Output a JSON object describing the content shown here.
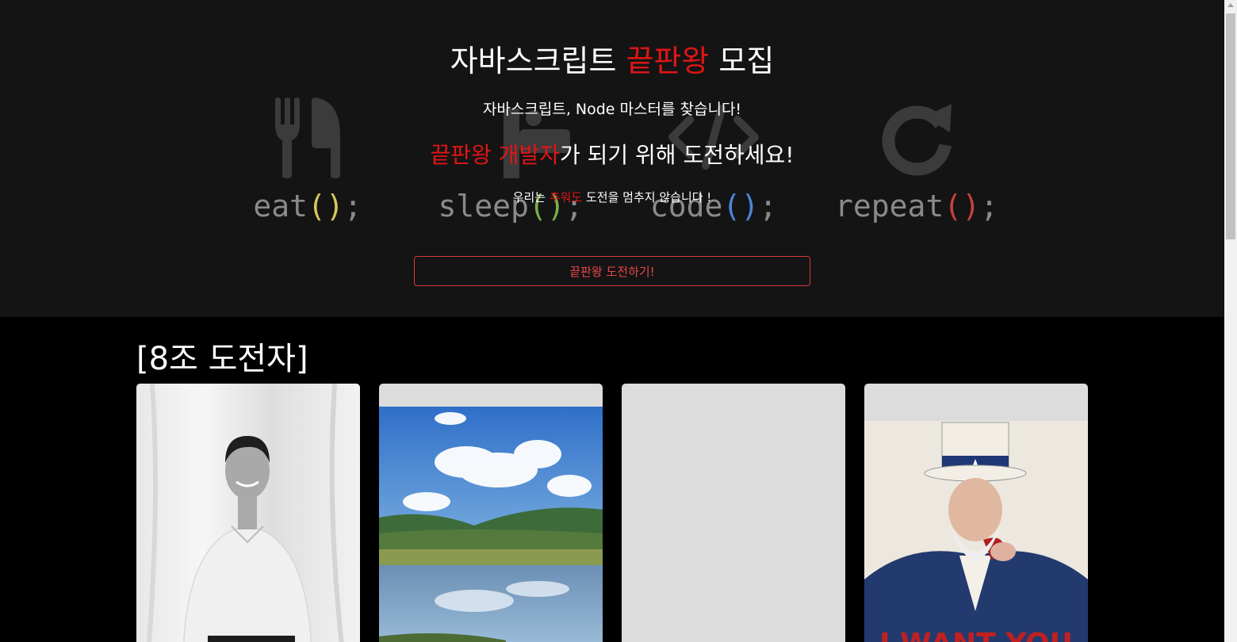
{
  "hero": {
    "title_part1": "자바스크립트",
    "title_highlight": "끝판왕",
    "title_part2": "모집",
    "subtitle": "자바스크립트, Node 마스터를 찾습니다!",
    "challenge_highlight": "끝판왕 개발자",
    "challenge_rest": "가 되기 위해 도전하세요!",
    "cold_prefix": "우리는 ",
    "cold_highlight": "추워도",
    "cold_suffix": " 도전을 멈추지 않습니다 !",
    "cta_label": "끝판왕 도전하기!",
    "background": [
      {
        "word": "eat",
        "paren_open": "(",
        "paren_close": ")",
        "semi": ";",
        "icon": "fork-knife-icon",
        "paren_color": "#d8c85a"
      },
      {
        "word": "sleep",
        "paren_open": "(",
        "paren_close": ")",
        "semi": ";",
        "icon": "bed-icon",
        "paren_color": "#78b048"
      },
      {
        "word": "code",
        "paren_open": "(",
        "paren_close": ")",
        "semi": ";",
        "icon": "code-icon",
        "paren_color": "#4a86d8"
      },
      {
        "word": "repeat",
        "paren_open": "(",
        "paren_close": ")",
        "semi": ";",
        "icon": "redo-icon",
        "paren_color": "#c84040"
      }
    ]
  },
  "team": {
    "title": "[8조 도전자]",
    "members": [
      {
        "photo": "portrait-photo"
      },
      {
        "photo": "landscape-photo"
      },
      {
        "photo": "empty-photo"
      },
      {
        "photo": "poster-photo"
      }
    ]
  },
  "colors": {
    "accent_red": "#e01515",
    "hero_bg": "#141414",
    "page_bg": "#000000",
    "card_bg": "#dcdcdc"
  }
}
